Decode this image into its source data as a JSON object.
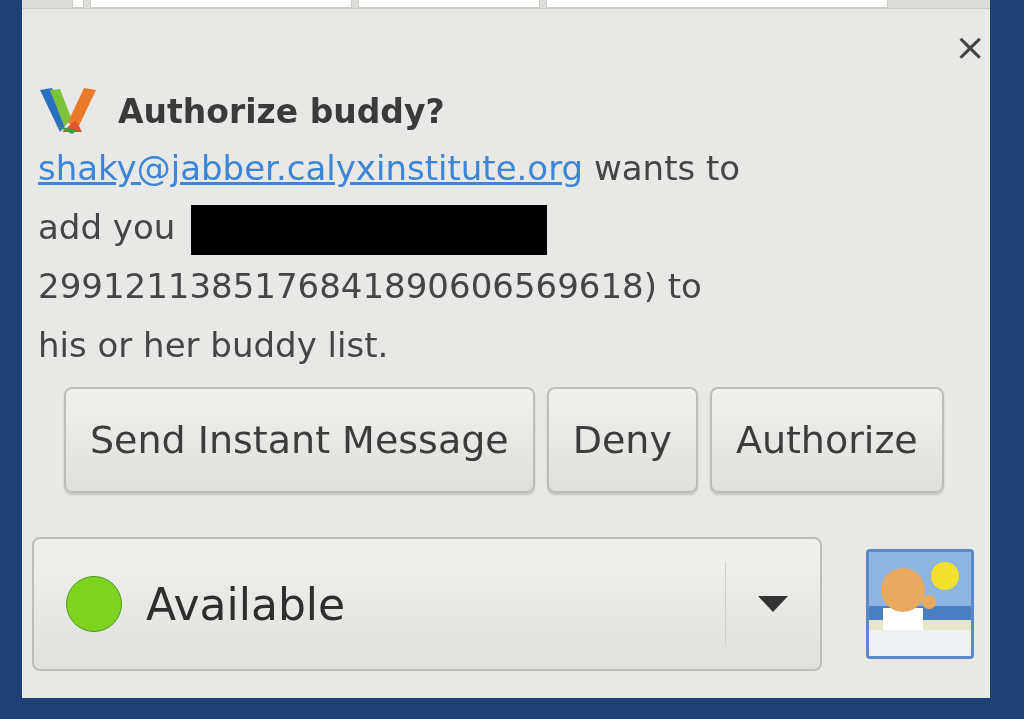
{
  "notification": {
    "close": "×",
    "title": "Authorize buddy?",
    "link": "shaky@jabber.calyxinstitute.org",
    "text_after_link": " wants to",
    "line_2": "add you",
    "line_3": "2991211385176841890606569618) to",
    "line_4": "his or her buddy list."
  },
  "buttons": [
    {
      "label": "Send Instant Message"
    },
    {
      "label": "Deny"
    },
    {
      "label": "Authorize"
    }
  ],
  "status": {
    "label": "Available",
    "color": "#7ed321"
  }
}
